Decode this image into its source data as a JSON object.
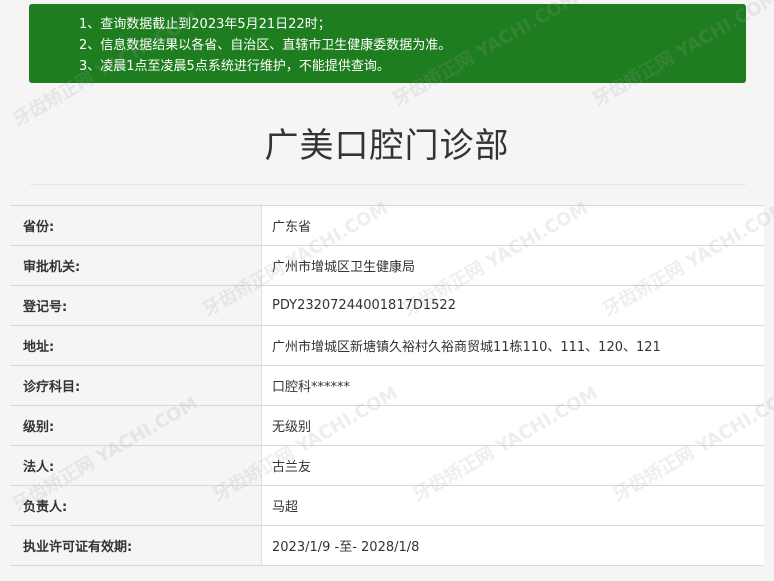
{
  "notice": {
    "lines": [
      "1、查询数据截止到2023年5月21日22时；",
      "2、信息数据结果以各省、自治区、直辖市卫生健康委数据为准。",
      "3、凌晨1点至凌晨5点系统进行维护，不能提供查询。"
    ]
  },
  "title": "广美口腔门诊部",
  "rows": [
    {
      "label": "省份:",
      "value": "广东省"
    },
    {
      "label": "审批机关:",
      "value": "广州市增城区卫生健康局"
    },
    {
      "label": "登记号:",
      "value": "PDY23207244001817D1522"
    },
    {
      "label": "地址:",
      "value": "广州市增城区新塘镇久裕村久裕商贸城11栋110、111、120、121"
    },
    {
      "label": "诊疗科目:",
      "value": "口腔科******"
    },
    {
      "label": "级别:",
      "value": "无级别"
    },
    {
      "label": "法人:",
      "value": "古兰友"
    },
    {
      "label": "负责人:",
      "value": "马超"
    },
    {
      "label": "执业许可证有效期:",
      "value": "2023/1/9 -至- 2028/1/8"
    }
  ],
  "watermark": "牙齿矫正网 YACHI.COM"
}
